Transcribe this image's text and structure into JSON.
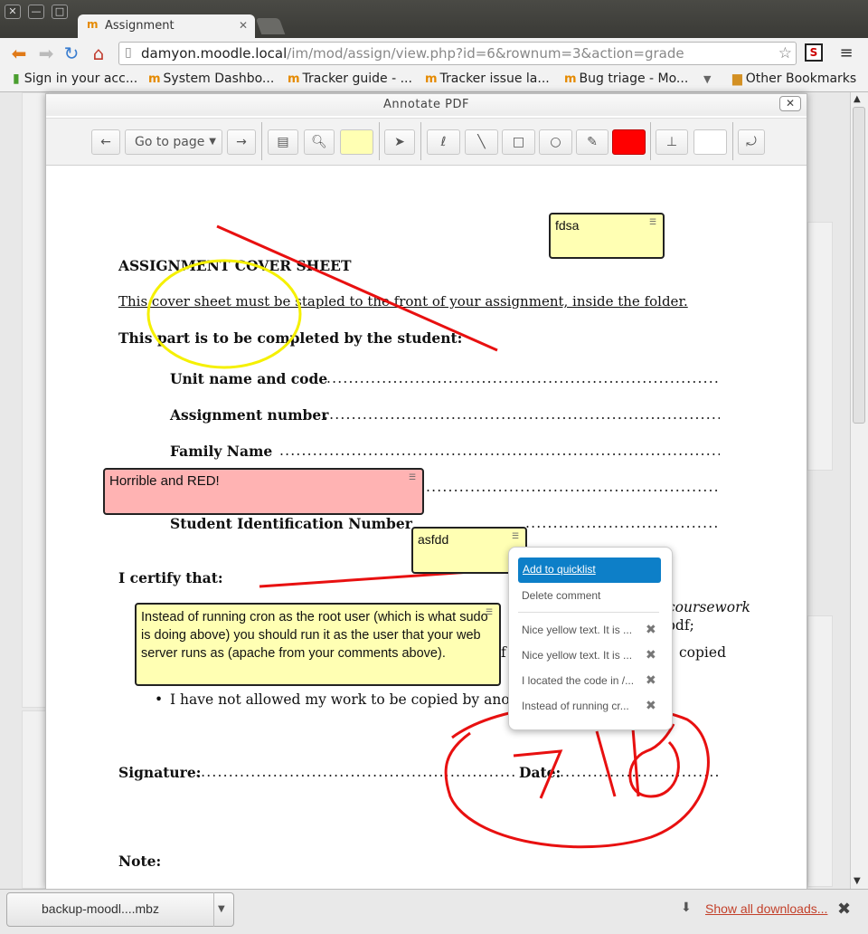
{
  "browser": {
    "tab_title": "Assignment",
    "url_host": "damyon.moodle.local",
    "url_path": "/im/mod/assign/view.php?id=6&rownum=3&action=grade",
    "bookmarks": [
      "Sign in your acc...",
      "System Dashbo...",
      "Tracker guide - ...",
      "Tracker issue la...",
      "Bug triage - Mo..."
    ],
    "other_bookmarks": "Other Bookmarks"
  },
  "dialog": {
    "title": "Annotate PDF",
    "close_label": "✕"
  },
  "toolbar": {
    "prev_label": "←",
    "goto_label": "Go to page",
    "next_label": "→",
    "highlight_color": "#ffffb3",
    "pen_color": "#ff0000",
    "undo_label": "⤾"
  },
  "document": {
    "heading": "ASSIGNMENT COVER SHEET",
    "subtitle": "This cover sheet must be stapled to the front of your assignment, inside the folder.",
    "student_part": "This part is to be completed by the student:",
    "fields": [
      "Unit name and code",
      "Assignment number",
      "Family Name",
      "Student Identification Number"
    ],
    "certify": "I certify that:",
    "frag_coursework": "coursework",
    "frag_pdf": "pdf;",
    "frag_f": "f",
    "frag_copied": "copied",
    "bullet_text": "I have not allowed my work to be copied by anothe",
    "signature": "Signature:",
    "date": "Date:",
    "note": "Note:"
  },
  "comments": {
    "fdsa": "fdsa",
    "red": "Horrible and RED!",
    "asfdd": "asfdd",
    "cron": "Instead of running cron as the root user (which is what sudo is doing above) you should run it as the user that your web server runs as (apache from your comments above)."
  },
  "popup": {
    "add_quicklist": "Add to quicklist",
    "delete_comment": "Delete comment",
    "quicklist": [
      "Nice yellow text. It is ...",
      "Nice yellow text. It is ...",
      "I located the code in /...",
      "Instead of running cr..."
    ]
  },
  "downloads": {
    "file": "backup-moodl....mbz",
    "show_all": "Show all downloads..."
  },
  "colors": {
    "yellow": "#ffffb3",
    "red_note": "#ffb3b3",
    "ink_red": "#e81010",
    "circle_yellow": "#f5f000",
    "accent_blue": "#0d7fc8"
  }
}
